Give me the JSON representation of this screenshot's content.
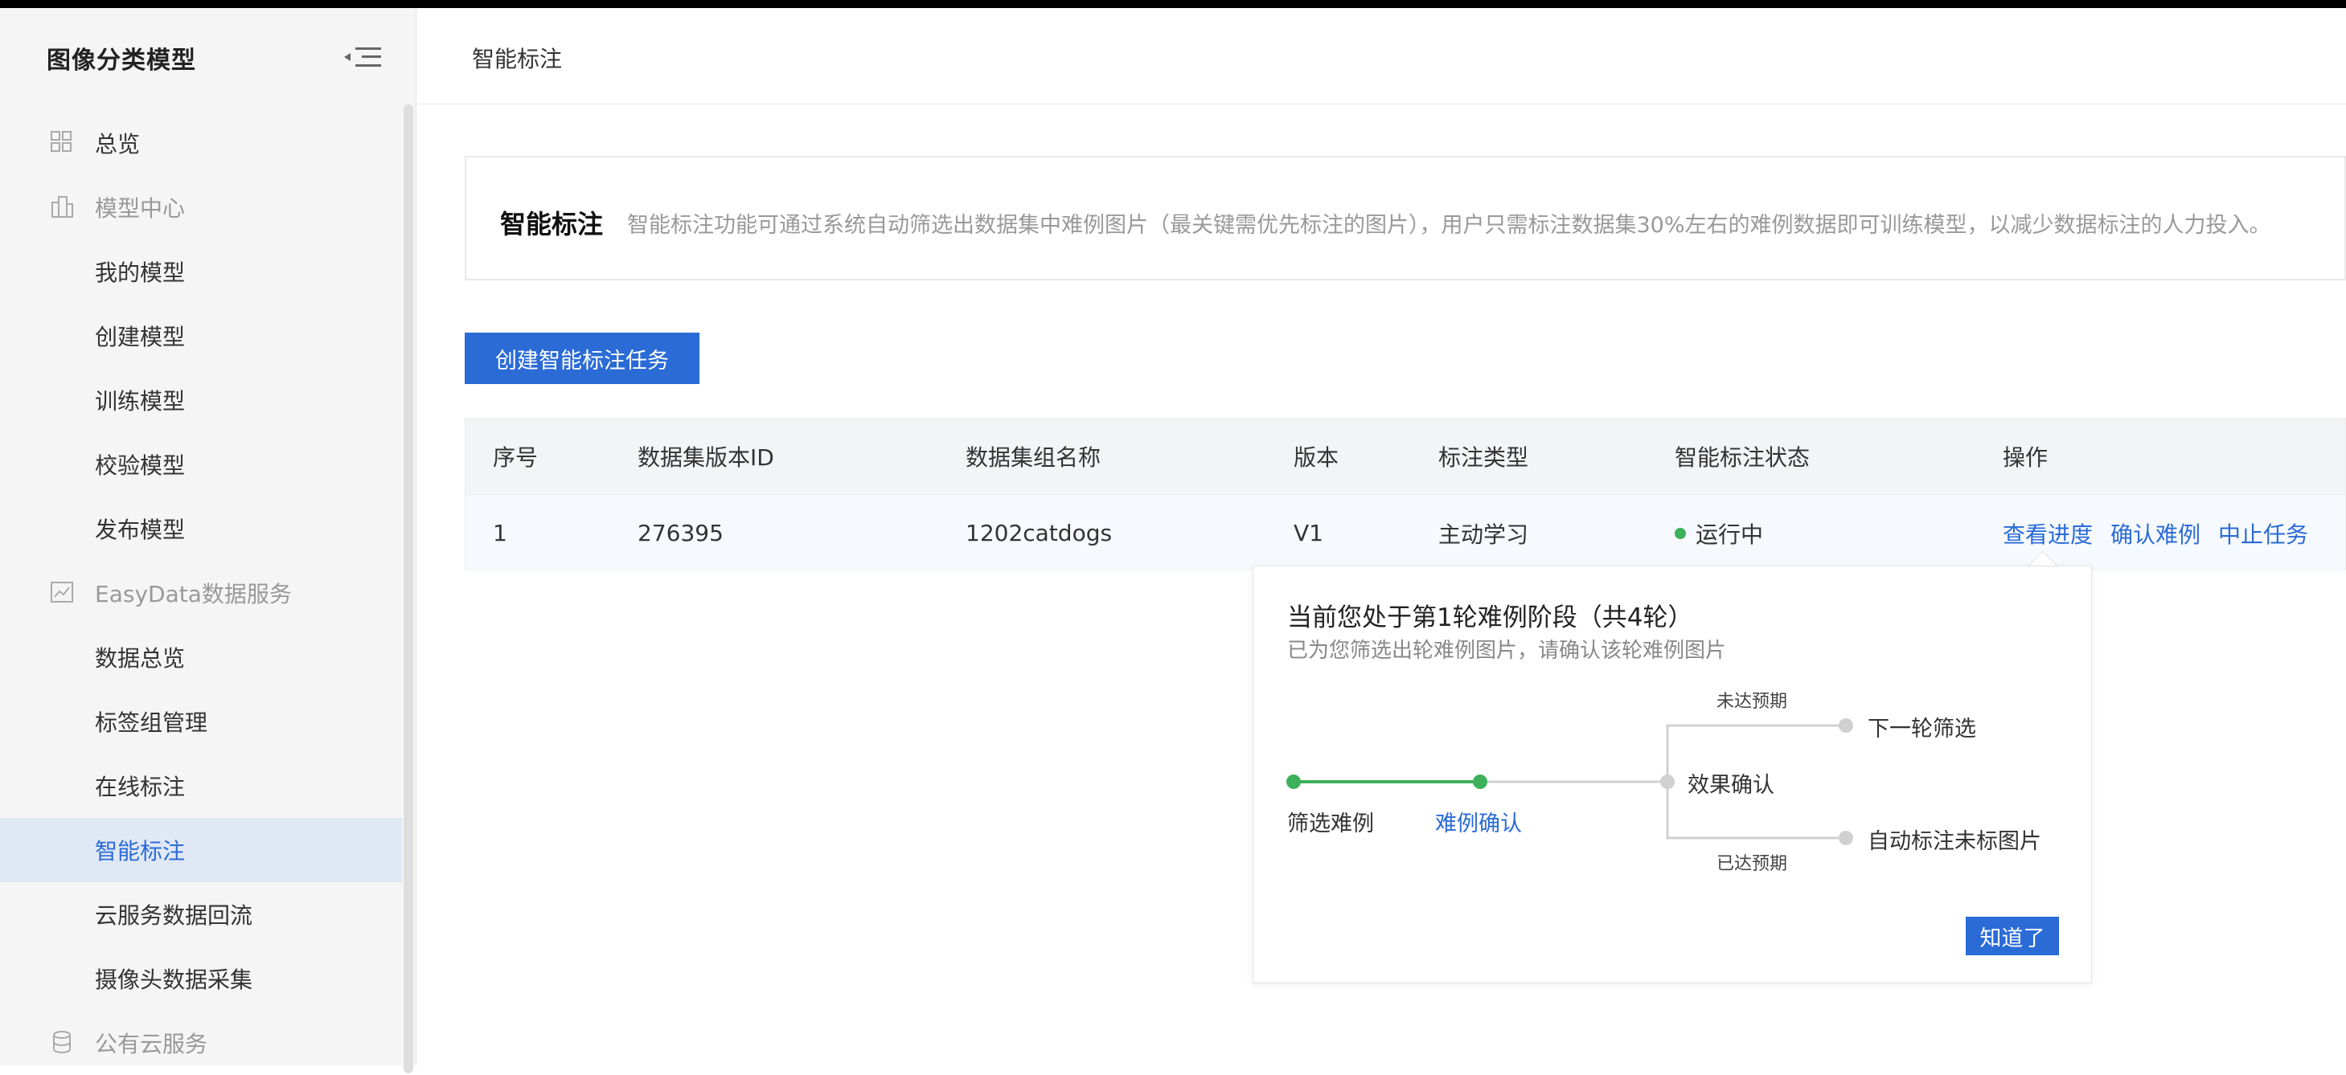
{
  "sidebar": {
    "title": "图像分类模型",
    "items": [
      {
        "label": "总览",
        "kind": "top",
        "icon": "grid-icon"
      },
      {
        "label": "模型中心",
        "kind": "group",
        "icon": "building-icon"
      },
      {
        "label": "我的模型",
        "kind": "item"
      },
      {
        "label": "创建模型",
        "kind": "item"
      },
      {
        "label": "训练模型",
        "kind": "item"
      },
      {
        "label": "校验模型",
        "kind": "item"
      },
      {
        "label": "发布模型",
        "kind": "item"
      },
      {
        "label": "EasyData数据服务",
        "kind": "group",
        "icon": "chart-icon"
      },
      {
        "label": "数据总览",
        "kind": "item"
      },
      {
        "label": "标签组管理",
        "kind": "item"
      },
      {
        "label": "在线标注",
        "kind": "item"
      },
      {
        "label": "智能标注",
        "kind": "item",
        "active": true
      },
      {
        "label": "云服务数据回流",
        "kind": "item"
      },
      {
        "label": "摄像头数据采集",
        "kind": "item"
      },
      {
        "label": "公有云服务",
        "kind": "group",
        "icon": "database-icon"
      }
    ]
  },
  "header": {
    "title": "智能标注"
  },
  "intro": {
    "title": "智能标注",
    "description": "智能标注功能可通过系统自动筛选出数据集中难例图片（最关键需优先标注的图片），用户只需标注数据集30%左右的难例数据即可训练模型，以减少数据标注的人力投入。"
  },
  "create_button": "创建智能标注任务",
  "table": {
    "columns": [
      "序号",
      "数据集版本ID",
      "数据集组名称",
      "版本",
      "标注类型",
      "智能标注状态",
      "操作"
    ],
    "rows": [
      {
        "index": "1",
        "dataset_version_id": "276395",
        "dataset_group_name": "1202catdogs",
        "version": "V1",
        "annotation_type": "主动学习",
        "status": "运行中",
        "actions": [
          "查看进度",
          "确认难例",
          "中止任务"
        ]
      }
    ]
  },
  "popover": {
    "title": "当前您处于第1轮难例阶段（共4轮）",
    "subtitle": "已为您筛选出轮难例图片，请确认该轮难例图片",
    "steps": [
      "筛选难例",
      "难例确认",
      "效果确认"
    ],
    "branch_top_condition": "未达预期",
    "branch_top_result": "下一轮筛选",
    "branch_bottom_condition": "已达预期",
    "branch_bottom_result": "自动标注未标图片",
    "ok_button": "知道了"
  },
  "colors": {
    "primary": "#2a6bd6",
    "success": "#3cb15a",
    "inactive": "#cccccc",
    "active_nav_bg": "#e1e8f5"
  }
}
